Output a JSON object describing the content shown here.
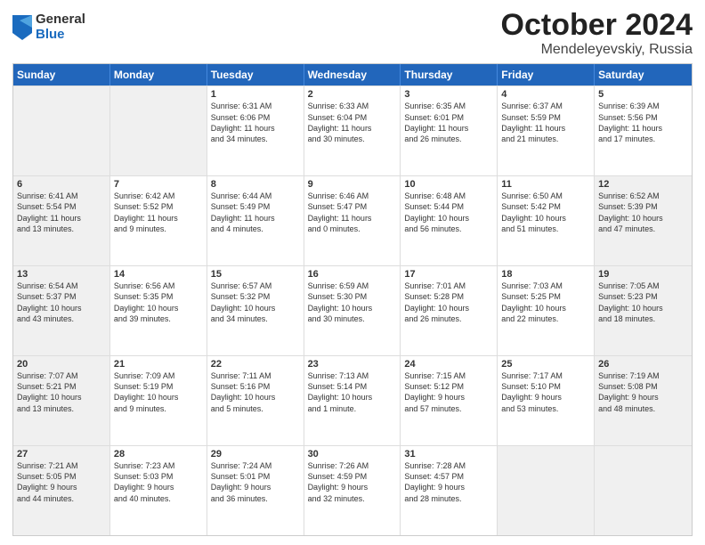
{
  "logo": {
    "general": "General",
    "blue": "Blue"
  },
  "title": {
    "month": "October 2024",
    "location": "Mendeleyevskiy, Russia"
  },
  "header_days": [
    "Sunday",
    "Monday",
    "Tuesday",
    "Wednesday",
    "Thursday",
    "Friday",
    "Saturday"
  ],
  "rows": [
    [
      {
        "day": "",
        "detail": "",
        "shaded": true
      },
      {
        "day": "",
        "detail": "",
        "shaded": true
      },
      {
        "day": "1",
        "detail": "Sunrise: 6:31 AM\nSunset: 6:06 PM\nDaylight: 11 hours\nand 34 minutes.",
        "shaded": false
      },
      {
        "day": "2",
        "detail": "Sunrise: 6:33 AM\nSunset: 6:04 PM\nDaylight: 11 hours\nand 30 minutes.",
        "shaded": false
      },
      {
        "day": "3",
        "detail": "Sunrise: 6:35 AM\nSunset: 6:01 PM\nDaylight: 11 hours\nand 26 minutes.",
        "shaded": false
      },
      {
        "day": "4",
        "detail": "Sunrise: 6:37 AM\nSunset: 5:59 PM\nDaylight: 11 hours\nand 21 minutes.",
        "shaded": false
      },
      {
        "day": "5",
        "detail": "Sunrise: 6:39 AM\nSunset: 5:56 PM\nDaylight: 11 hours\nand 17 minutes.",
        "shaded": false
      }
    ],
    [
      {
        "day": "6",
        "detail": "Sunrise: 6:41 AM\nSunset: 5:54 PM\nDaylight: 11 hours\nand 13 minutes.",
        "shaded": true
      },
      {
        "day": "7",
        "detail": "Sunrise: 6:42 AM\nSunset: 5:52 PM\nDaylight: 11 hours\nand 9 minutes.",
        "shaded": false
      },
      {
        "day": "8",
        "detail": "Sunrise: 6:44 AM\nSunset: 5:49 PM\nDaylight: 11 hours\nand 4 minutes.",
        "shaded": false
      },
      {
        "day": "9",
        "detail": "Sunrise: 6:46 AM\nSunset: 5:47 PM\nDaylight: 11 hours\nand 0 minutes.",
        "shaded": false
      },
      {
        "day": "10",
        "detail": "Sunrise: 6:48 AM\nSunset: 5:44 PM\nDaylight: 10 hours\nand 56 minutes.",
        "shaded": false
      },
      {
        "day": "11",
        "detail": "Sunrise: 6:50 AM\nSunset: 5:42 PM\nDaylight: 10 hours\nand 51 minutes.",
        "shaded": false
      },
      {
        "day": "12",
        "detail": "Sunrise: 6:52 AM\nSunset: 5:39 PM\nDaylight: 10 hours\nand 47 minutes.",
        "shaded": true
      }
    ],
    [
      {
        "day": "13",
        "detail": "Sunrise: 6:54 AM\nSunset: 5:37 PM\nDaylight: 10 hours\nand 43 minutes.",
        "shaded": true
      },
      {
        "day": "14",
        "detail": "Sunrise: 6:56 AM\nSunset: 5:35 PM\nDaylight: 10 hours\nand 39 minutes.",
        "shaded": false
      },
      {
        "day": "15",
        "detail": "Sunrise: 6:57 AM\nSunset: 5:32 PM\nDaylight: 10 hours\nand 34 minutes.",
        "shaded": false
      },
      {
        "day": "16",
        "detail": "Sunrise: 6:59 AM\nSunset: 5:30 PM\nDaylight: 10 hours\nand 30 minutes.",
        "shaded": false
      },
      {
        "day": "17",
        "detail": "Sunrise: 7:01 AM\nSunset: 5:28 PM\nDaylight: 10 hours\nand 26 minutes.",
        "shaded": false
      },
      {
        "day": "18",
        "detail": "Sunrise: 7:03 AM\nSunset: 5:25 PM\nDaylight: 10 hours\nand 22 minutes.",
        "shaded": false
      },
      {
        "day": "19",
        "detail": "Sunrise: 7:05 AM\nSunset: 5:23 PM\nDaylight: 10 hours\nand 18 minutes.",
        "shaded": true
      }
    ],
    [
      {
        "day": "20",
        "detail": "Sunrise: 7:07 AM\nSunset: 5:21 PM\nDaylight: 10 hours\nand 13 minutes.",
        "shaded": true
      },
      {
        "day": "21",
        "detail": "Sunrise: 7:09 AM\nSunset: 5:19 PM\nDaylight: 10 hours\nand 9 minutes.",
        "shaded": false
      },
      {
        "day": "22",
        "detail": "Sunrise: 7:11 AM\nSunset: 5:16 PM\nDaylight: 10 hours\nand 5 minutes.",
        "shaded": false
      },
      {
        "day": "23",
        "detail": "Sunrise: 7:13 AM\nSunset: 5:14 PM\nDaylight: 10 hours\nand 1 minute.",
        "shaded": false
      },
      {
        "day": "24",
        "detail": "Sunrise: 7:15 AM\nSunset: 5:12 PM\nDaylight: 9 hours\nand 57 minutes.",
        "shaded": false
      },
      {
        "day": "25",
        "detail": "Sunrise: 7:17 AM\nSunset: 5:10 PM\nDaylight: 9 hours\nand 53 minutes.",
        "shaded": false
      },
      {
        "day": "26",
        "detail": "Sunrise: 7:19 AM\nSunset: 5:08 PM\nDaylight: 9 hours\nand 48 minutes.",
        "shaded": true
      }
    ],
    [
      {
        "day": "27",
        "detail": "Sunrise: 7:21 AM\nSunset: 5:05 PM\nDaylight: 9 hours\nand 44 minutes.",
        "shaded": true
      },
      {
        "day": "28",
        "detail": "Sunrise: 7:23 AM\nSunset: 5:03 PM\nDaylight: 9 hours\nand 40 minutes.",
        "shaded": false
      },
      {
        "day": "29",
        "detail": "Sunrise: 7:24 AM\nSunset: 5:01 PM\nDaylight: 9 hours\nand 36 minutes.",
        "shaded": false
      },
      {
        "day": "30",
        "detail": "Sunrise: 7:26 AM\nSunset: 4:59 PM\nDaylight: 9 hours\nand 32 minutes.",
        "shaded": false
      },
      {
        "day": "31",
        "detail": "Sunrise: 7:28 AM\nSunset: 4:57 PM\nDaylight: 9 hours\nand 28 minutes.",
        "shaded": false
      },
      {
        "day": "",
        "detail": "",
        "shaded": true
      },
      {
        "day": "",
        "detail": "",
        "shaded": true
      }
    ]
  ]
}
